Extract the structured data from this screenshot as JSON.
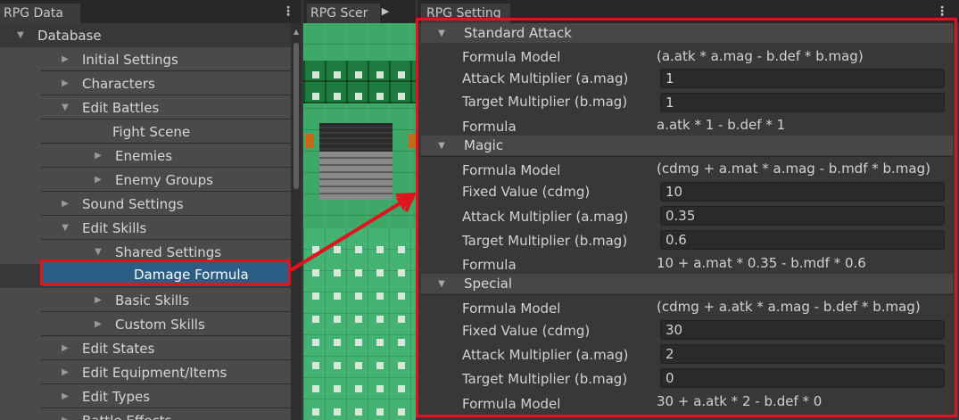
{
  "tabs": {
    "left": "RPG Data",
    "middle": "RPG Scer",
    "right": "RPG Setting"
  },
  "tree": {
    "items": [
      {
        "label": "Database",
        "arrow": "▼"
      },
      {
        "label": "Initial Settings",
        "arrow": "▶"
      },
      {
        "label": "Characters",
        "arrow": "▶"
      },
      {
        "label": "Edit Battles",
        "arrow": "▼"
      },
      {
        "label": "Fight Scene",
        "arrow": ""
      },
      {
        "label": "Enemies",
        "arrow": "▶"
      },
      {
        "label": "Enemy Groups",
        "arrow": "▶"
      },
      {
        "label": "Sound Settings",
        "arrow": "▶"
      },
      {
        "label": "Edit Skills",
        "arrow": "▼"
      },
      {
        "label": "Shared Settings",
        "arrow": "▼"
      },
      {
        "label": "Damage Formula",
        "arrow": ""
      },
      {
        "label": "Basic Skills",
        "arrow": "▶"
      },
      {
        "label": "Custom Skills",
        "arrow": "▶"
      },
      {
        "label": "Edit States",
        "arrow": "▶"
      },
      {
        "label": "Edit Equipment/Items",
        "arrow": "▶"
      },
      {
        "label": "Edit Types",
        "arrow": "▶"
      },
      {
        "label": "Battle Effects",
        "arrow": "▶"
      }
    ]
  },
  "sections": [
    {
      "title": "Standard Attack",
      "arrow": "▼",
      "formula_model_label": "Formula Model",
      "formula_model": "(a.atk * a.mag - b.def * b.mag)",
      "attack_label": "Attack Multiplier  (a.mag)",
      "attack_value": "1",
      "target_label": "Target Multiplier  (b.mag)",
      "target_value": "1",
      "formula_label": "Formula",
      "formula": "a.atk * 1 - b.def * 1"
    },
    {
      "title": "Magic",
      "arrow": "▼",
      "formula_model_label": "Formula Model",
      "formula_model": "(cdmg + a.mat * a.mag - b.mdf * b.mag)",
      "fixed_label": "Fixed Value  (cdmg)",
      "fixed_value": "10",
      "attack_label": "Attack Multiplier  (a.mag)",
      "attack_value": "0.35",
      "target_label": "Target Multiplier  (b.mag)",
      "target_value": "0.6",
      "formula_label": "Formula",
      "formula": "10 + a.mat * 0.35 - b.mdf * 0.6"
    },
    {
      "title": "Special",
      "arrow": "▼",
      "formula_model_label": "Formula Model",
      "formula_model": "(cdmg + a.atk * a.mag - b.def * b.mag)",
      "fixed_label": "Fixed Value  (cdmg)",
      "fixed_value": "30",
      "attack_label": "Attack Multiplier  (a.mag)",
      "attack_value": "2",
      "target_label": "Target Multiplier  (b.mag)",
      "target_value": "0",
      "formula_label": "Formula Model",
      "formula": "30 + a.atk * 2 - b.def * 0"
    }
  ],
  "icons": {
    "kebab": "⋮",
    "play": "▶",
    "scroll_up": "▲"
  },
  "colors": {
    "highlight": "#e0141c",
    "selection": "#2c5d87"
  }
}
